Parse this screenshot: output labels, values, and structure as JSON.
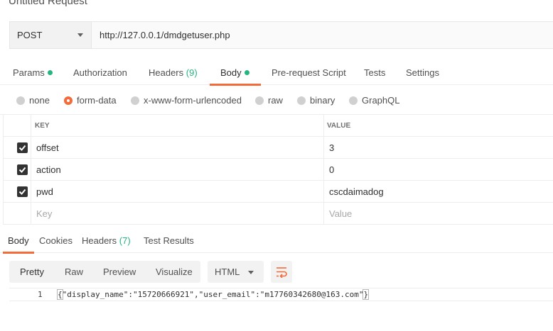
{
  "title": "Untitled Request",
  "request": {
    "method": "POST",
    "url": "http://127.0.0.1/dmdgetuser.php"
  },
  "request_tabs": [
    {
      "label": "Params",
      "dot": true
    },
    {
      "label": "Authorization"
    },
    {
      "label": "Headers",
      "count": "(9)"
    },
    {
      "label": "Body",
      "dot": true,
      "active": true
    },
    {
      "label": "Pre-request Script"
    },
    {
      "label": "Tests"
    },
    {
      "label": "Settings"
    }
  ],
  "body_types": [
    {
      "label": "none",
      "checked": false
    },
    {
      "label": "form-data",
      "checked": true
    },
    {
      "label": "x-www-form-urlencoded",
      "checked": false
    },
    {
      "label": "raw",
      "checked": false
    },
    {
      "label": "binary",
      "checked": false
    },
    {
      "label": "GraphQL",
      "checked": false
    }
  ],
  "form_table": {
    "headers": {
      "key": "KEY",
      "value": "VALUE"
    },
    "rows": [
      {
        "key": "offset",
        "value": "3",
        "checked": true
      },
      {
        "key": "action",
        "value": "0",
        "checked": true
      },
      {
        "key": "pwd",
        "value": "cscdaimadog",
        "checked": true
      }
    ],
    "placeholder": {
      "key": "Key",
      "value": "Value"
    }
  },
  "response_tabs": [
    {
      "label": "Body",
      "active": true
    },
    {
      "label": "Cookies"
    },
    {
      "label": "Headers",
      "count": "(7)"
    },
    {
      "label": "Test Results"
    }
  ],
  "response_toolbar": {
    "formats": [
      "Pretty",
      "Raw",
      "Preview",
      "Visualize"
    ],
    "active_format": "Pretty",
    "language": "HTML"
  },
  "response_body": {
    "line_number": "1",
    "open_brace": "{",
    "content": "\"display_name\":\"15720666921\",\"user_email\":\"m17760342680@163.com\"",
    "close_brace": "}"
  },
  "colors": {
    "accent": "#f26b3a",
    "status_green": "#26b47f"
  }
}
